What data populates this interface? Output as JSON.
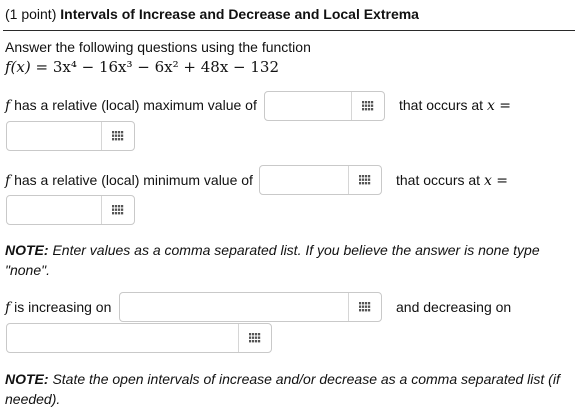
{
  "header": {
    "points": "(1 point)",
    "title": "Intervals of Increase and Decrease and Local Extrema"
  },
  "intro": {
    "text": "Answer the following questions using the function",
    "function_name": "f(x)",
    "function_rhs": "= 3x⁴ − 16x³ − 6x² + 48x − 132"
  },
  "q_max": {
    "prefix": "f",
    "label": "has a relative (local) maximum value of",
    "occurs_label": "that occurs at",
    "x_eq": "x ="
  },
  "q_min": {
    "prefix": "f",
    "label": "has a relative (local) minimum value of",
    "occurs_label": "that occurs at",
    "x_eq": "x ="
  },
  "note1": {
    "bold": "NOTE:",
    "text": "Enter values as a comma separated list. If you believe the answer is none type \"none\"."
  },
  "q_inc": {
    "prefix": "f",
    "label": "is increasing on",
    "dec_label": "and decreasing on"
  },
  "note2": {
    "bold": "NOTE:",
    "text": "State the open intervals of increase and/or decrease as a comma separated list (if needed)."
  },
  "fields": {
    "max_value": "",
    "max_x": "",
    "min_value": "",
    "min_x": "",
    "increasing": "",
    "decreasing": ""
  },
  "icons": {
    "grid": "grid-icon",
    "grid_color": "#555555"
  }
}
